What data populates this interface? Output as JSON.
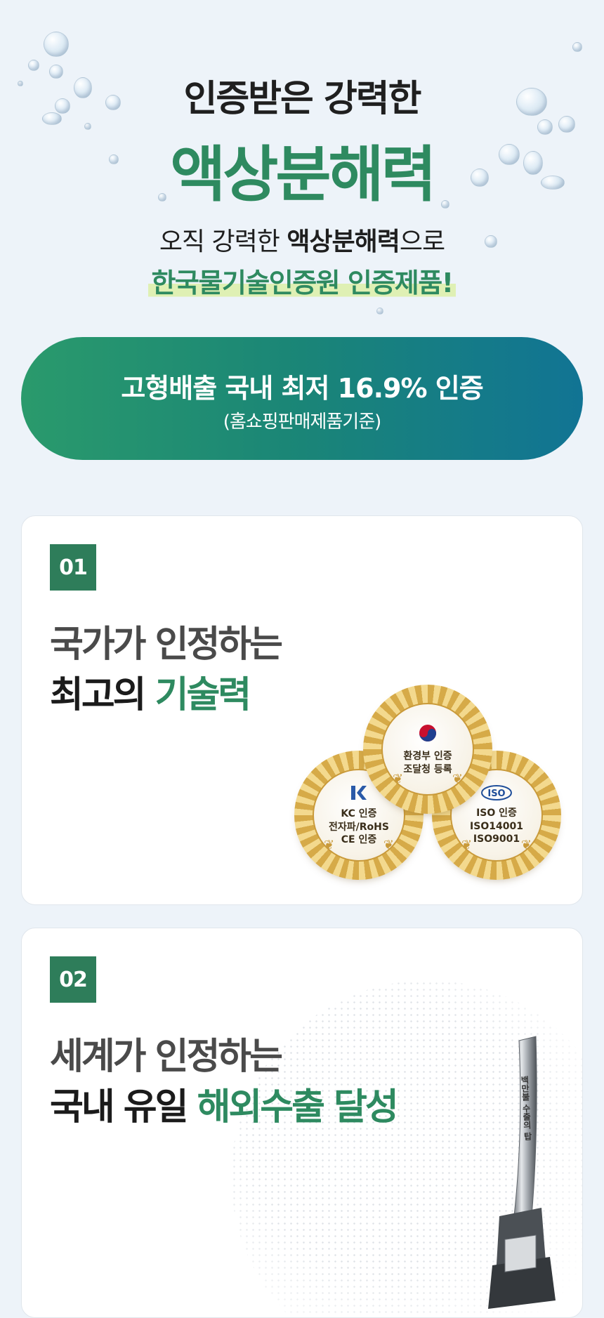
{
  "hero": {
    "line1": "인증받은 강력한",
    "title": "액상분해력",
    "sub_prefix": "오직 강력한 ",
    "sub_bold": "액상분해력",
    "sub_suffix": "으로",
    "highlight": "한국물기술인증원 인증제품!"
  },
  "cert_pill": {
    "main": "고형배출 국내 최저 16.9% 인증",
    "sub": "(홈쇼핑판매제품기준)"
  },
  "card1": {
    "number": "01",
    "line1": "국가가 인정하는",
    "line2_prefix": "최고의 ",
    "line2_green": "기술력",
    "medals": [
      {
        "icon": "korea-emblem-icon",
        "lines": [
          "환경부 인증",
          "조달청 등록"
        ]
      },
      {
        "icon": "kc-mark-icon",
        "lines": [
          "KC 인증",
          "전자파/RoHS",
          "CE 인증"
        ]
      },
      {
        "icon": "iso-logo-icon",
        "lines": [
          "ISO 인증",
          "ISO14001",
          "ISO9001"
        ]
      }
    ]
  },
  "card2": {
    "number": "02",
    "line1": "세계가 인정하는",
    "line2_prefix": "국내 유일 ",
    "line2_green": "해외수출 달성",
    "trophy_text": "백만불 수출의 탑"
  },
  "colors": {
    "accent_green": "#2e8a60",
    "badge_green": "#2e7d5a",
    "pill_start": "#2a9a6c",
    "pill_end": "#117494",
    "highlight": "#dff0b4",
    "background": "#edf3f9"
  }
}
